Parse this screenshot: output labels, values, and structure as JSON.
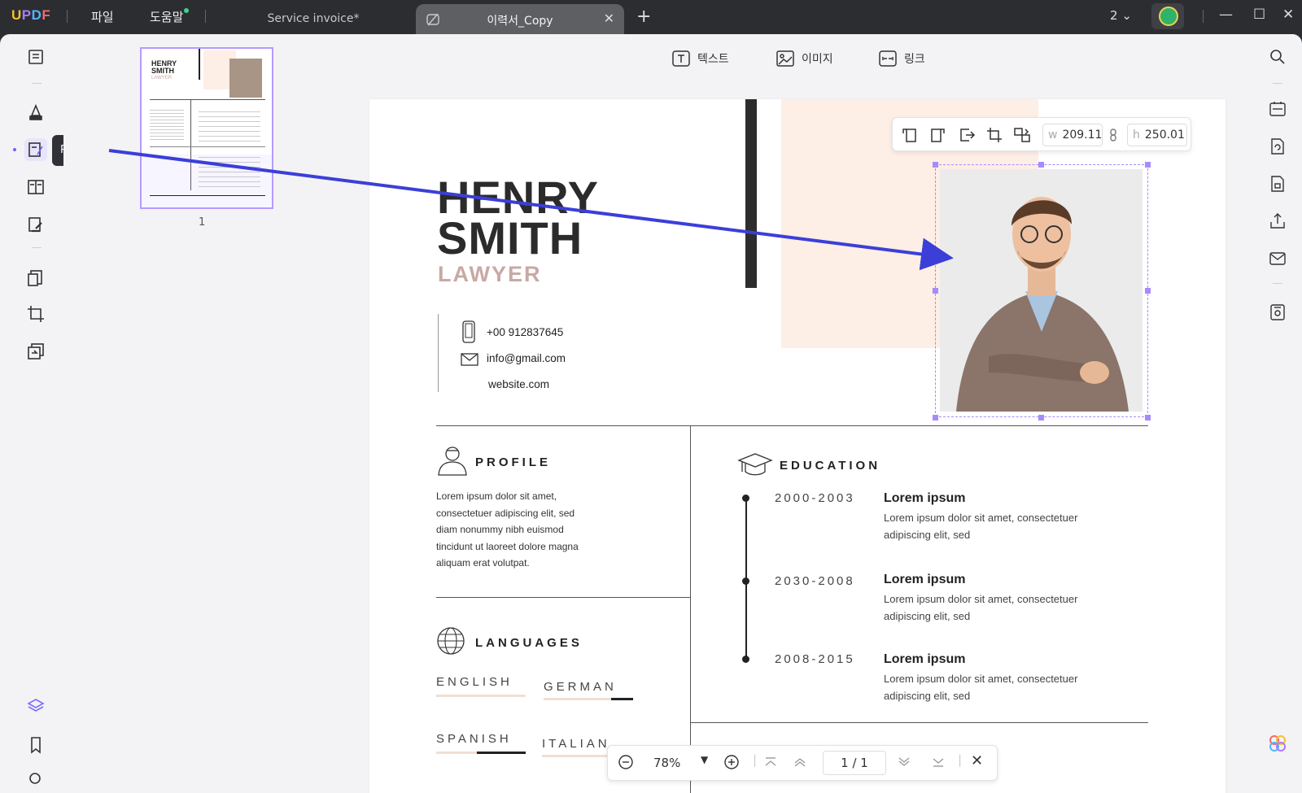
{
  "app": {
    "logo": {
      "u": "U",
      "p": "P",
      "d": "D",
      "f": "F"
    },
    "menu": {
      "file": "파일",
      "help": "도움말"
    },
    "tabs": [
      {
        "label": "Service invoice*"
      },
      {
        "label": "이력서_Copy"
      }
    ],
    "page_count": "2",
    "colors": {
      "accent": "#6c63ff",
      "selection": "#a68bff",
      "arrow": "#3b3fd8",
      "peach": "#fdeee6",
      "role": "#c8a9a4"
    }
  },
  "left_rail": {
    "tooltip": "PDF 편집",
    "items": [
      "reader-icon",
      "comment-icon",
      "edit-pdf-icon",
      "organize-icon",
      "fill-sign-icon",
      "convert-icon",
      "crop-icon",
      "compress-icon",
      "layers-icon",
      "bookmark-icon",
      "search-icon"
    ]
  },
  "thumbnails": [
    {
      "page": "1"
    }
  ],
  "edit_toolbar": {
    "text": "텍스트",
    "image": "이미지",
    "link": "링크"
  },
  "image_toolbar": {
    "w_label": "w",
    "w_value": "209.11",
    "h_label": "h",
    "h_value": "250.01"
  },
  "resume": {
    "first_name": "HENRY",
    "last_name": "SMITH",
    "role": "LAWYER",
    "phone": "+00 912837645",
    "email": "info@gmail.com",
    "website": "website.com",
    "profile": {
      "title": "PROFILE",
      "lines": [
        "Lorem ipsum dolor sit amet,",
        "consectetuer adipiscing elit, sed",
        "diam nonummy nibh euismod",
        "tincidunt ut laoreet dolore magna",
        "aliquam erat volutpat."
      ]
    },
    "languages": {
      "title": "LANGUAGES",
      "items": [
        {
          "name": "ENGLISH",
          "level": 0
        },
        {
          "name": "GERMAN",
          "level": 0.25
        },
        {
          "name": "SPANISH",
          "level": 0.55
        },
        {
          "name": "ITALIAN",
          "level": 0
        }
      ]
    },
    "education": {
      "title": "EDUCATION",
      "items": [
        {
          "years": "2000-2003",
          "heading": "Lorem ipsum",
          "line1": "Lorem ipsum dolor sit amet, consectetuer",
          "line2": "adipiscing elit, sed"
        },
        {
          "years": "2030-2008",
          "heading": "Lorem ipsum",
          "line1": "Lorem ipsum dolor sit amet, consectetuer",
          "line2": "adipiscing elit, sed"
        },
        {
          "years": "2008-2015",
          "heading": "Lorem ipsum",
          "line1": "Lorem ipsum dolor sit amet, consectetuer",
          "line2": "adipiscing elit, sed"
        }
      ]
    }
  },
  "bottom_bar": {
    "zoom": "78%",
    "page": "1 / 1"
  },
  "thumb_mini": {
    "name1": "HENRY",
    "name2": "SMITH",
    "role": "LAWYER"
  }
}
